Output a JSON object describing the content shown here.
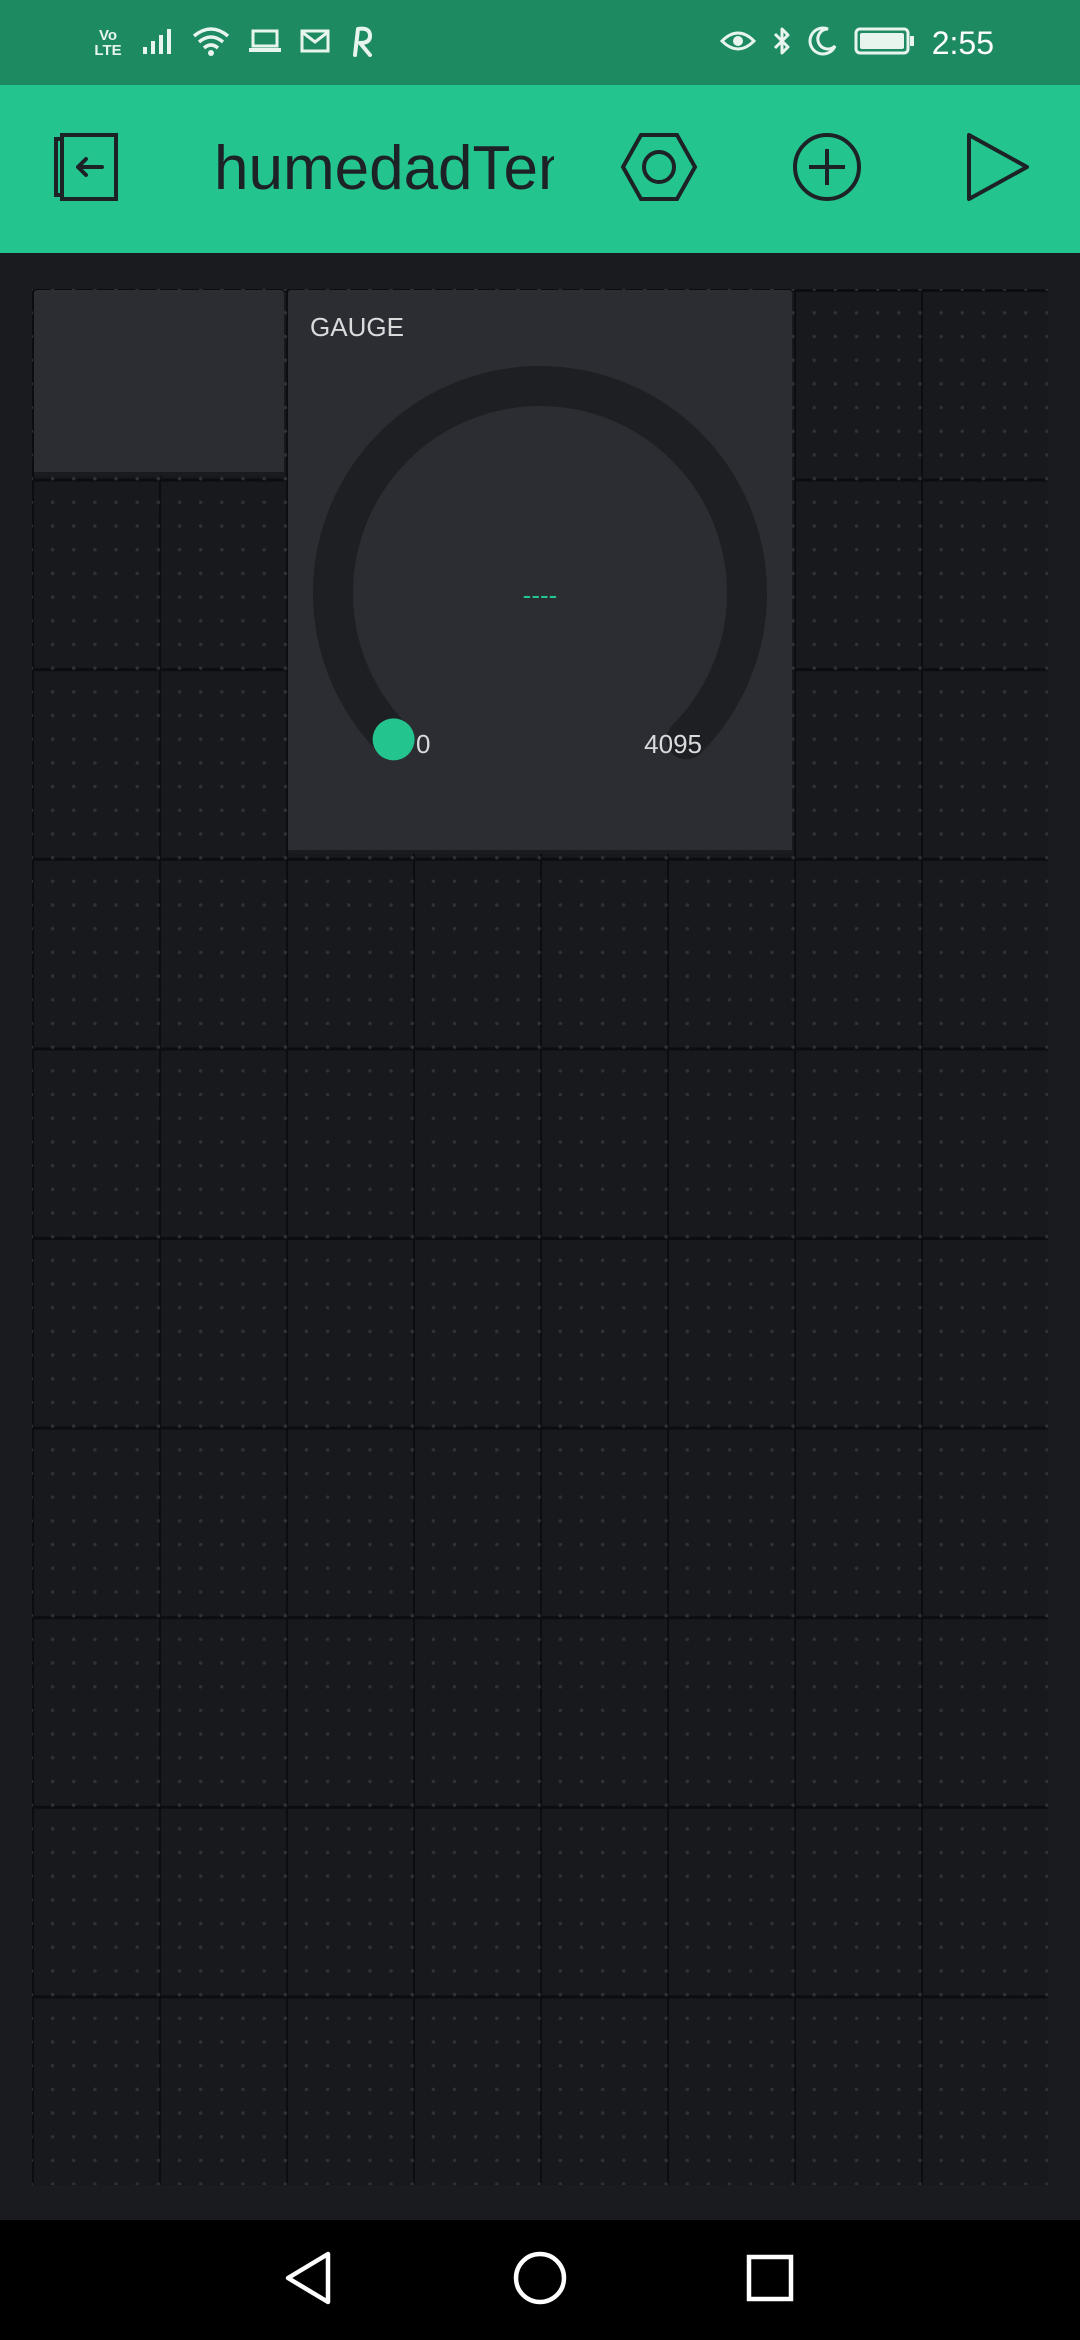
{
  "status_bar": {
    "volte_top": "Vo",
    "volte_bottom": "LTE",
    "time": "2:55",
    "icons": [
      "volte-icon",
      "signal-icon",
      "wifi-icon",
      "laptop-icon",
      "mail-icon",
      "r-app-icon",
      "eye-icon",
      "bluetooth-icon",
      "moon-icon",
      "battery-icon"
    ]
  },
  "app_bar": {
    "title": "humedadTemperatura",
    "icons": [
      "exit-icon",
      "settings-nut-icon",
      "add-circle-icon",
      "play-icon"
    ]
  },
  "gauge": {
    "label": "GAUGE",
    "value_display": "----",
    "min": "0",
    "max": "4095",
    "level_fraction": 0
  },
  "colors": {
    "accent": "#23c48e",
    "status_bar": "#1e8a62",
    "widget_bg": "#2b2d32",
    "canvas_bg": "#1a1b1f"
  },
  "nav_bar": {
    "icons": [
      "back-triangle-icon",
      "home-circle-icon",
      "recents-square-icon"
    ]
  }
}
